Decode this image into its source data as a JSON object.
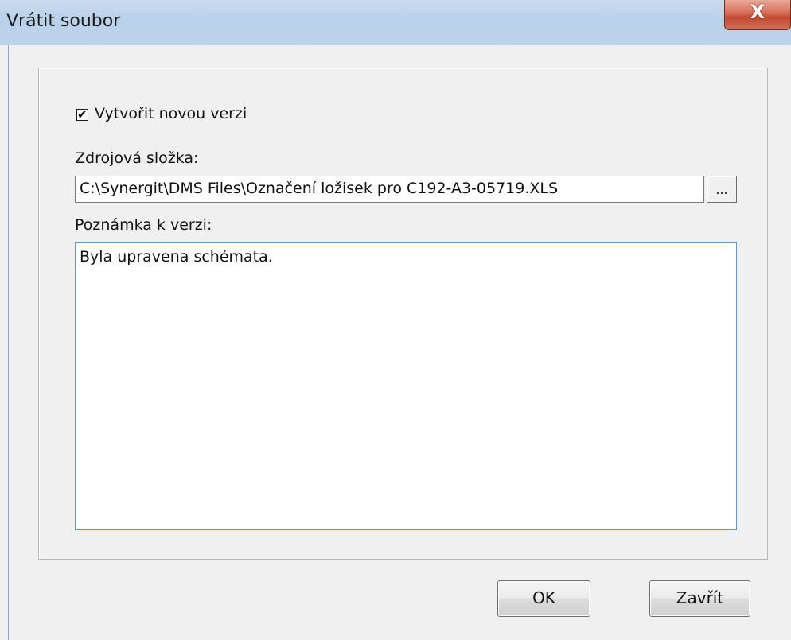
{
  "window": {
    "title": "Vrátit soubor",
    "close_glyph": "X"
  },
  "form": {
    "create_version": {
      "label": "Vytvořit novou verzi",
      "checked": true
    },
    "source_folder": {
      "label": "Zdrojová složka:",
      "value": "C:\\Synergit\\DMS Files\\Označení ložisek pro C192-A3-05719.XLS",
      "browse_label": "..."
    },
    "version_note": {
      "label": "Poznámka k verzi:",
      "value": "Byla upravena schémata."
    }
  },
  "buttons": {
    "ok_label": "OK",
    "close_label": "Zavřít"
  }
}
